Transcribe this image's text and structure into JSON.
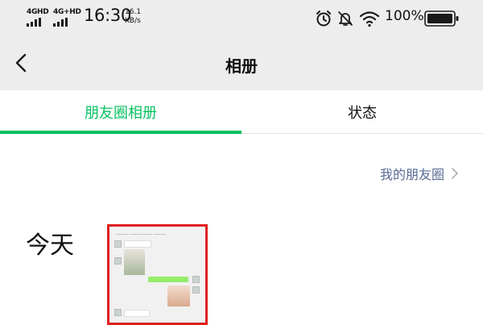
{
  "status_bar": {
    "network_1": "4GHD",
    "network_2": "4G+HD",
    "time": "16:30",
    "speed_value": "16.1",
    "speed_unit": "KB/s",
    "battery": "100%",
    "icons": [
      "alarm-icon",
      "bell-off-icon",
      "wifi-icon",
      "battery-icon"
    ]
  },
  "nav": {
    "back_icon": "chevron-left-icon",
    "title": "相册"
  },
  "tabs": [
    {
      "label": "朋友圈相册",
      "active": true
    },
    {
      "label": "状态",
      "active": false
    }
  ],
  "my_moments": {
    "label": "我的朋友圈",
    "icon": "chevron-right-icon"
  },
  "date_label": "今天",
  "colors": {
    "accent": "#07c160",
    "link": "#576b95",
    "highlight_border": "#e02020"
  }
}
